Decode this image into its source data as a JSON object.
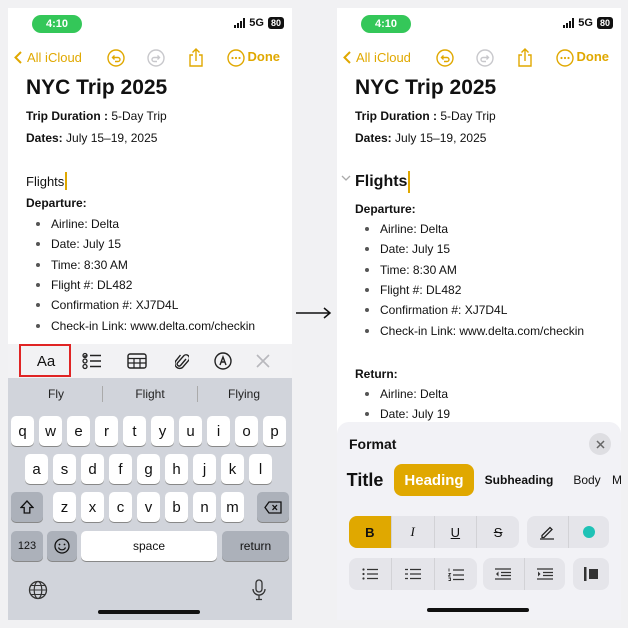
{
  "status": {
    "time": "4:10",
    "network": "5G",
    "battery": "80"
  },
  "nav": {
    "back_label": "All iCloud",
    "done_label": "Done"
  },
  "note": {
    "title": "NYC Trip 2025",
    "duration_label": "Trip Duration :",
    "duration_value": " 5-Day Trip",
    "dates_label": "Dates:",
    "dates_value": " July 15–19, 2025",
    "section_flights": "Flights",
    "departure_label": "Departure:",
    "departure_items": [
      "Airline: Delta",
      "Date: July 15",
      "Time: 8:30 AM",
      "Flight #: DL482",
      "Confirmation #: XJ7D4L",
      "Check-in Link: www.delta.com/checkin"
    ],
    "return_label": "Return:",
    "return_items": [
      "Airline: Delta",
      "Date: July 19"
    ]
  },
  "toolbar": {
    "format_label": "Aa"
  },
  "keyboard": {
    "suggestions": [
      "Fly",
      "Flight",
      "Flying"
    ],
    "row1": [
      "q",
      "w",
      "e",
      "r",
      "t",
      "y",
      "u",
      "i",
      "o",
      "p"
    ],
    "row2": [
      "a",
      "s",
      "d",
      "f",
      "g",
      "h",
      "j",
      "k",
      "l"
    ],
    "row3": [
      "z",
      "x",
      "c",
      "v",
      "b",
      "n",
      "m"
    ],
    "numbers_label": "123",
    "space_label": "space",
    "return_label": "return"
  },
  "format_panel": {
    "title": "Format",
    "styles": {
      "title": "Title",
      "heading": "Heading",
      "subheading": "Subheading",
      "body": "Body"
    },
    "text_buttons": {
      "bold": "B",
      "italic": "I",
      "underline": "U",
      "strikethrough": "S"
    },
    "accent_color": "#e0a800",
    "highlight_color": "#1fc2b6"
  }
}
